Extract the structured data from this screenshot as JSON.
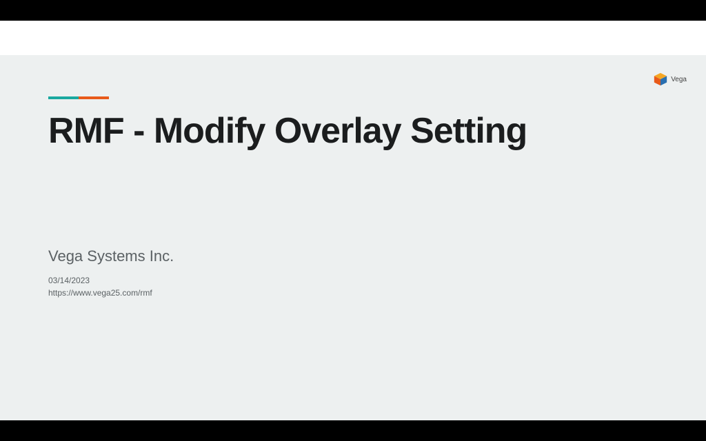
{
  "logo": {
    "label": "Vega"
  },
  "slide": {
    "title": "RMF - Modify Overlay Setting",
    "company": "Vega Systems Inc.",
    "date": "03/14/2023",
    "url": "https://www.vega25.com/rmf"
  },
  "accent_colors": {
    "left": "#1aa9a0",
    "right": "#e85a1a"
  }
}
